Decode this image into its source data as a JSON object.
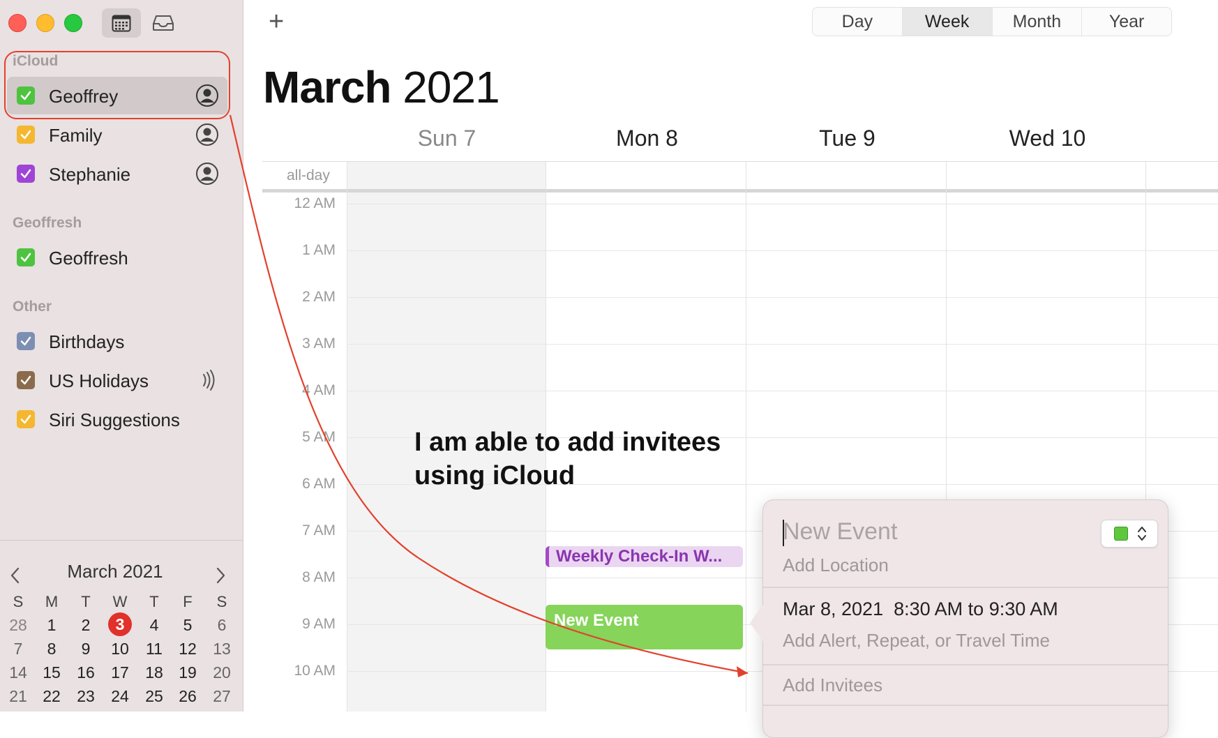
{
  "sidebar": {
    "groups": [
      {
        "title": "iCloud",
        "items": [
          {
            "label": "Geoffrey",
            "color": "#4ec33f",
            "selected": true,
            "icon": "person-circle-icon"
          },
          {
            "label": "Family",
            "color": "#f5b731",
            "icon": "person-circle-icon"
          },
          {
            "label": "Stephanie",
            "color": "#a044d6",
            "icon": "person-circle-icon"
          }
        ]
      },
      {
        "title": "Geoffresh",
        "items": [
          {
            "label": "Geoffresh",
            "color": "#4ec33f"
          }
        ]
      },
      {
        "title": "Other",
        "items": [
          {
            "label": "Birthdays",
            "color": "#7c8fb3"
          },
          {
            "label": "US Holidays",
            "color": "#8a6b4c",
            "icon": "subscription-broadcast-icon"
          },
          {
            "label": "Siri Suggestions",
            "color": "#f5b731"
          }
        ]
      }
    ],
    "mini_calendar": {
      "title": "March 2021",
      "weekdays": [
        "S",
        "M",
        "T",
        "W",
        "T",
        "F",
        "S"
      ],
      "weeks": [
        [
          "28",
          "1",
          "2",
          "3",
          "4",
          "5",
          "6"
        ],
        [
          "7",
          "8",
          "9",
          "10",
          "11",
          "12",
          "13"
        ],
        [
          "14",
          "15",
          "16",
          "17",
          "18",
          "19",
          "20"
        ],
        [
          "21",
          "22",
          "23",
          "24",
          "25",
          "26",
          "27"
        ]
      ],
      "today": "3"
    }
  },
  "toolbar": {
    "add_label": "+",
    "views": [
      "Day",
      "Week",
      "Month",
      "Year"
    ],
    "active_view": "Week"
  },
  "header": {
    "month": "March",
    "year": "2021"
  },
  "week": {
    "days": [
      "Sun 7",
      "Mon 8",
      "Tue 9",
      "Wed 10"
    ],
    "allday_label": "all-day",
    "hours": [
      "12 AM",
      "1 AM",
      "2 AM",
      "3 AM",
      "4 AM",
      "5 AM",
      "6 AM",
      "7 AM",
      "8 AM",
      "9 AM",
      "10 AM"
    ]
  },
  "events": {
    "weekly": {
      "title": "Weekly Check-In W...",
      "color": "#a447c8"
    },
    "new": {
      "title": "New Event",
      "color": "#86d45a"
    }
  },
  "annotation": {
    "line1": "I am able to add invitees",
    "line2": "using iCloud"
  },
  "popover": {
    "title_placeholder": "New Event",
    "location_placeholder": "Add Location",
    "date": "Mar 8, 2021",
    "time": "8:30 AM to 9:30 AM",
    "alert_placeholder": "Add Alert, Repeat, or Travel Time",
    "invitees_placeholder": "Add Invitees",
    "color": "#5ec73e"
  },
  "colors": {
    "annotation_red": "#e2412c",
    "today_red": "#e0312a"
  }
}
